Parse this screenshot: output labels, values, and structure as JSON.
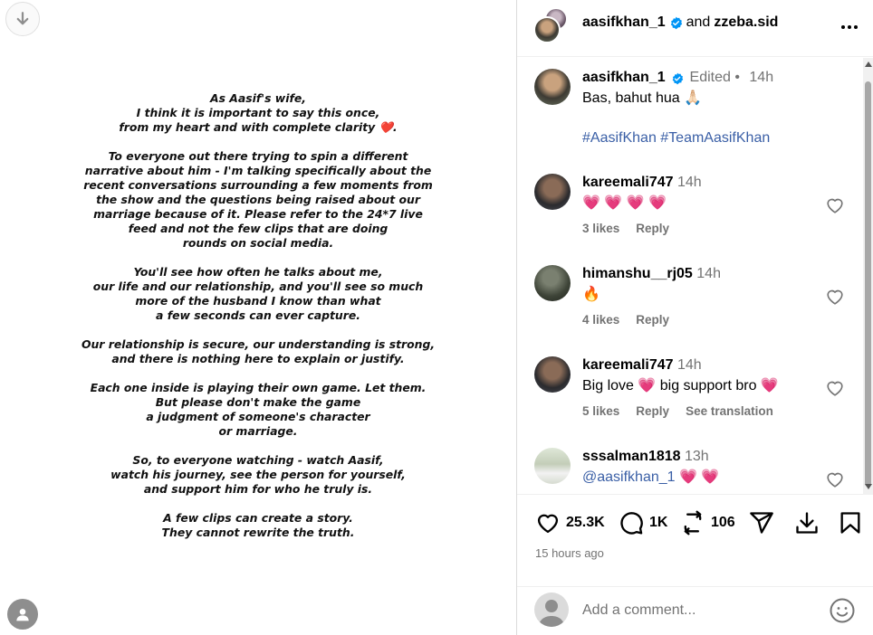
{
  "media": {
    "statement": [
      "As Aasif's wife,\nI think it is important to say this once,\nfrom my heart and with complete clarity ❤️.",
      "To everyone out there trying to spin a different\nnarrative about him - I'm talking specifically about the\nrecent conversations surrounding a few moments from\nthe show and the questions being raised about our\nmarriage because of it. Please refer to the 24*7 live\nfeed and not the few clips that are doing\nrounds on social media.",
      "You'll see how often he talks about me,\nour life and our relationship, and you'll see so much\nmore of the husband I know than what\na few seconds can ever capture.",
      "Our relationship is secure, our understanding is strong,\nand there is nothing here to explain or justify.",
      "Each one inside is playing their own game. Let them.\nBut please don't make the game\na judgment of someone's character\nor marriage.",
      "So, to everyone watching - watch Aasif,\nwatch his journey, see the person for yourself,\nand support him for who he truly is.",
      "A few clips can create a story.\nThey cannot rewrite the truth."
    ]
  },
  "header": {
    "author": "aasifkhan_1",
    "joiner": "and",
    "collaborator": "zzeba.sid"
  },
  "caption": {
    "username": "aasifkhan_1",
    "edited": "Edited",
    "dot": "•",
    "time": "14h",
    "text": "Bas, bahut hua 🙏🏻",
    "hashtags": "#AasifKhan #TeamAasifKhan"
  },
  "comments": [
    {
      "username": "kareemali747",
      "time": "14h",
      "text": "💗 💗 💗 💗",
      "likes": "3 likes",
      "reply": "Reply",
      "translate": ""
    },
    {
      "username": "himanshu__rj05",
      "time": "14h",
      "text": "🔥",
      "likes": "4 likes",
      "reply": "Reply",
      "translate": ""
    },
    {
      "username": "kareemali747",
      "time": "14h",
      "text": "Big love 💗 big support bro 💗",
      "likes": "5 likes",
      "reply": "Reply",
      "translate": "See translation"
    },
    {
      "username": "sssalman1818",
      "time": "13h",
      "mention": "@aasifkhan_1",
      "text": " 💗 💗"
    }
  ],
  "actions": {
    "likes": "25.3K",
    "comments": "1K",
    "reposts": "106"
  },
  "posted": "15 hours ago",
  "add_comment": {
    "placeholder": "Add a comment..."
  },
  "colors": {
    "verified": "#0095f6",
    "link": "#3a5fa6",
    "muted": "#737373"
  }
}
